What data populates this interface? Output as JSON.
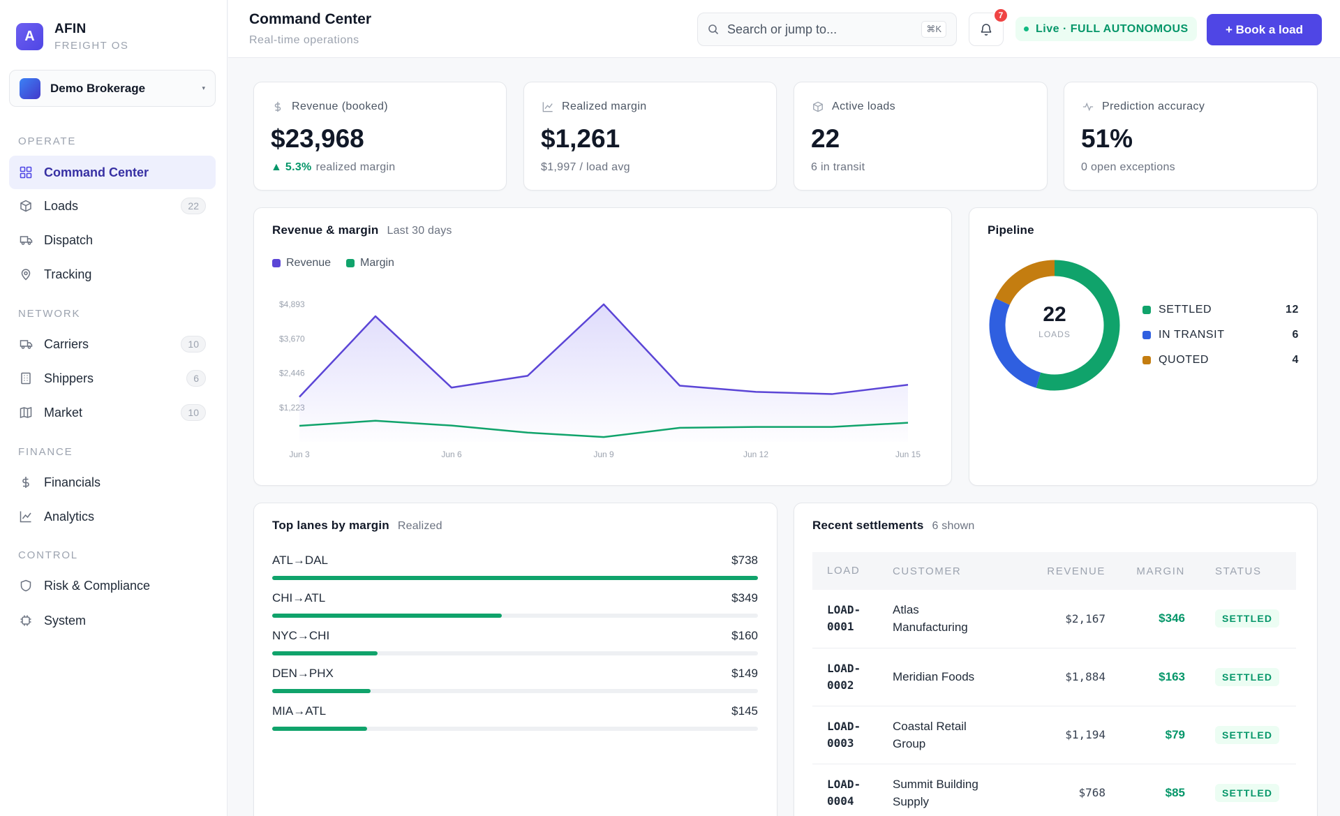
{
  "brand": {
    "logo_letter": "A",
    "name": "AFIN",
    "subtitle": "FREIGHT OS"
  },
  "org": {
    "name": "Demo Brokerage",
    "caret": "▾"
  },
  "sidebar": {
    "sections": [
      "OPERATE",
      "NETWORK",
      "FINANCE",
      "CONTROL"
    ],
    "items": [
      {
        "label": "Command Center",
        "icon": "grid-icon",
        "badge": ""
      },
      {
        "label": "Loads",
        "icon": "box-icon",
        "badge": "22"
      },
      {
        "label": "Dispatch",
        "icon": "truck-icon",
        "badge": ""
      },
      {
        "label": "Tracking",
        "icon": "pin-icon",
        "badge": ""
      },
      {
        "label": "Carriers",
        "icon": "truck-icon",
        "badge": "10"
      },
      {
        "label": "Shippers",
        "icon": "building-icon",
        "badge": "6"
      },
      {
        "label": "Market",
        "icon": "map-icon",
        "badge": "10"
      },
      {
        "label": "Financials",
        "icon": "dollar-icon",
        "badge": ""
      },
      {
        "label": "Analytics",
        "icon": "chart-icon",
        "badge": ""
      },
      {
        "label": "Risk & Compliance",
        "icon": "shield-icon",
        "badge": ""
      },
      {
        "label": "System",
        "icon": "chip-icon",
        "badge": ""
      }
    ]
  },
  "header": {
    "title": "Command Center",
    "subtitle": "Real-time operations",
    "search_placeholder": "Search or jump to...",
    "search_shortcut": "⌘K",
    "notifications": "7",
    "live_status": "Live · FULL AUTONOMOUS",
    "book_button": "+ Book a load"
  },
  "kpis": [
    {
      "label": "Revenue (booked)",
      "icon": "dollar-icon",
      "value": "$23,968",
      "delta": "▲ 5.3%",
      "sub": "realized margin"
    },
    {
      "label": "Realized margin",
      "icon": "chart-icon",
      "value": "$1,261",
      "delta": "",
      "sub": "$1,997 / load avg"
    },
    {
      "label": "Active loads",
      "icon": "box-icon",
      "value": "22",
      "delta": "",
      "sub": "6 in transit"
    },
    {
      "label": "Prediction accuracy",
      "icon": "pulse-icon",
      "value": "51%",
      "delta": "",
      "sub": "0 open exceptions"
    }
  ],
  "revenue_card": {
    "title": "Revenue & margin",
    "subtitle": "Last 30 days"
  },
  "pipeline_card": {
    "title": "Pipeline",
    "center_value": "22",
    "center_label": "LOADS",
    "items": [
      {
        "label": "SETTLED",
        "value": "12",
        "color": "#10a36b"
      },
      {
        "label": "IN TRANSIT",
        "value": "6",
        "color": "#2f5fe0"
      },
      {
        "label": "QUOTED",
        "value": "4",
        "color": "#c47d10"
      }
    ]
  },
  "lanes_card": {
    "title": "Top lanes by margin",
    "subtitle": "Realized",
    "lanes": [
      {
        "lane": "ATL→DAL",
        "value": "$738",
        "fill": 1.0
      },
      {
        "lane": "CHI→ATL",
        "value": "$349",
        "fill": 0.473
      },
      {
        "lane": "NYC→CHI",
        "value": "$160",
        "fill": 0.217
      },
      {
        "lane": "DEN→PHX",
        "value": "$149",
        "fill": 0.202
      },
      {
        "lane": "MIA→ATL",
        "value": "$145",
        "fill": 0.196
      }
    ]
  },
  "settlements_card": {
    "title": "Recent settlements",
    "subtitle": "6 shown",
    "columns": [
      "LOAD",
      "CUSTOMER",
      "REVENUE",
      "MARGIN",
      "STATUS"
    ],
    "rows": [
      {
        "load_a": "LOAD-",
        "load_b": "0001",
        "customer_a": "Atlas",
        "customer_b": "Manufacturing",
        "revenue": "$2,167",
        "margin": "$346",
        "status": "SETTLED"
      },
      {
        "load_a": "LOAD-",
        "load_b": "0002",
        "customer_a": "Meridian Foods",
        "customer_b": "",
        "revenue": "$1,884",
        "margin": "$163",
        "status": "SETTLED"
      },
      {
        "load_a": "LOAD-",
        "load_b": "0003",
        "customer_a": "Coastal Retail",
        "customer_b": "Group",
        "revenue": "$1,194",
        "margin": "$79",
        "status": "SETTLED"
      },
      {
        "load_a": "LOAD-",
        "load_b": "0004",
        "customer_a": "Summit Building",
        "customer_b": "Supply",
        "revenue": "$768",
        "margin": "$85",
        "status": "SETTLED"
      }
    ]
  },
  "colors": {
    "accent": "#4f46e5",
    "revenue": "#5b45d6",
    "margin": "#10a36b"
  },
  "chart_data": [
    {
      "type": "area",
      "title": "Revenue & margin",
      "subtitle": "Last 30 days",
      "x": [
        "Jun 3",
        "Jun 5",
        "Jun 6",
        "Jun 8",
        "Jun 9",
        "Jun 10",
        "Jun 12",
        "Jun 13",
        "Jun 15"
      ],
      "x_ticks": [
        "Jun 3",
        "Jun 6",
        "Jun 9",
        "Jun 12",
        "Jun 15"
      ],
      "y_ticks": [
        "$1,223",
        "$2,446",
        "$3,670",
        "$4,893"
      ],
      "ylim": [
        0,
        4893
      ],
      "grid": false,
      "legend": "top-left",
      "series": [
        {
          "name": "Revenue",
          "color": "#5b45d6",
          "values": [
            1600,
            4470,
            1930,
            2350,
            4893,
            2000,
            1780,
            1700,
            2030
          ]
        },
        {
          "name": "Margin",
          "color": "#10a36b",
          "values": [
            570,
            750,
            580,
            330,
            170,
            500,
            530,
            530,
            680
          ]
        }
      ]
    },
    {
      "type": "pie",
      "title": "Pipeline",
      "categories": [
        "SETTLED",
        "IN TRANSIT",
        "QUOTED"
      ],
      "values": [
        12,
        6,
        4
      ],
      "colors": [
        "#10a36b",
        "#2f5fe0",
        "#c47d10"
      ],
      "legend": "right"
    }
  ]
}
